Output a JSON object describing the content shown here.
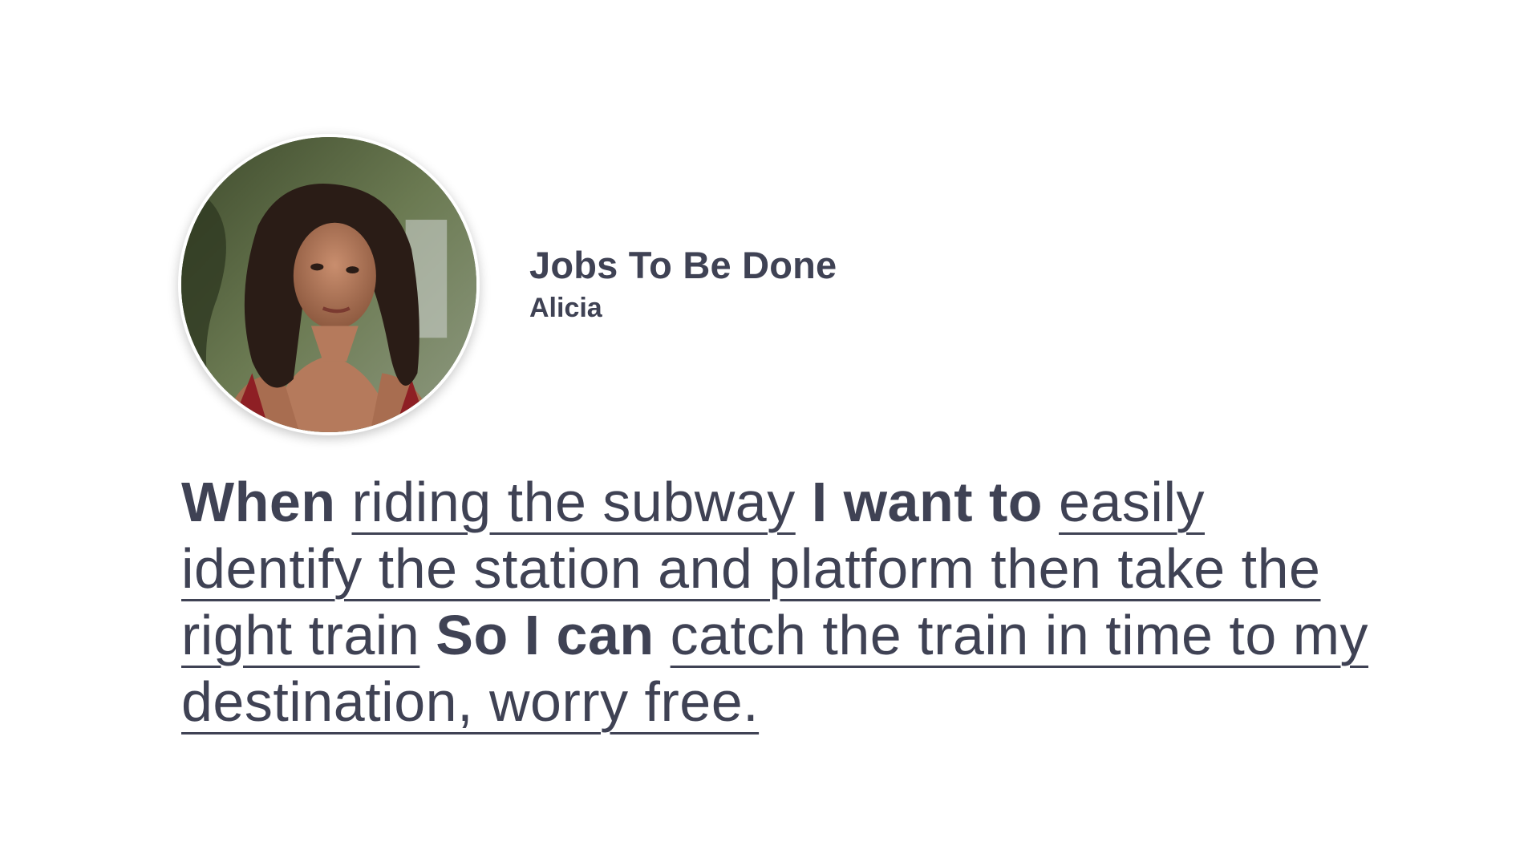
{
  "header": {
    "title": "Jobs To Be Done",
    "persona_name": "Alicia"
  },
  "statement": {
    "when_keyword": "When",
    "when_text": "riding the subway",
    "want_keyword": "I want to",
    "want_text": "easily identify the station and platform then take the right train",
    "so_keyword": "So I can",
    "so_text": "catch the train in time to my destination, worry free."
  }
}
